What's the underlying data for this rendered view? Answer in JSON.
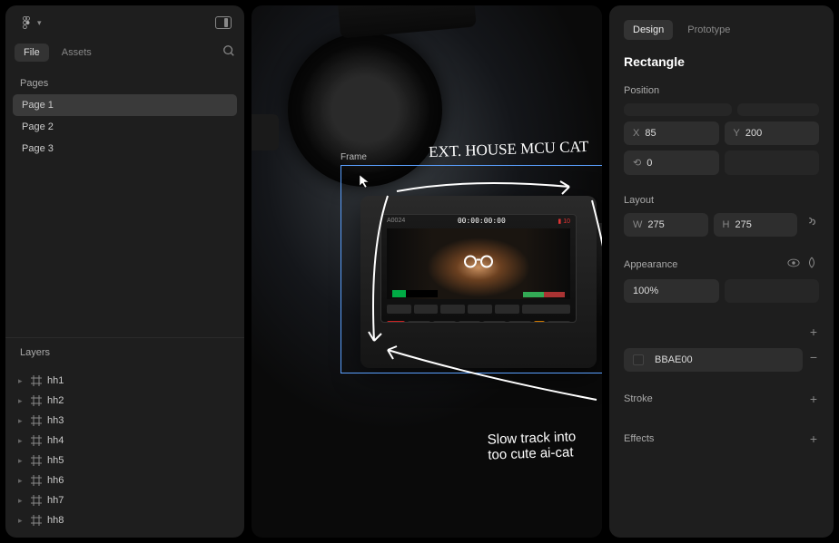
{
  "leftTabs": {
    "file": "File",
    "assets": "Assets"
  },
  "pagesHeader": "Pages",
  "pages": [
    "Page 1",
    "Page 2",
    "Page 3"
  ],
  "activePage": 0,
  "layersHeader": "Layers",
  "layers": [
    "hh1",
    "hh2",
    "hh3",
    "hh4",
    "hh5",
    "hh6",
    "hh7",
    "hh8"
  ],
  "canvas": {
    "frameLabel": "Frame",
    "annotationTop": "EXT. HOUSE  MCU CAT",
    "annotationBottom1": "Slow track into",
    "annotationBottom2": "too cute ai-cat",
    "timecode": "00:00:00:00"
  },
  "right": {
    "tabDesign": "Design",
    "tabPrototype": "Prototype",
    "title": "Rectangle",
    "positionLabel": "Position",
    "xLabel": "X",
    "xVal": "85",
    "yLabel": "Y",
    "yVal": "200",
    "rotIcon": "⟲",
    "rotVal": "0",
    "layoutLabel": "Layout",
    "wLabel": "W",
    "wVal": "275",
    "hLabel": "H",
    "hVal": "275",
    "appearanceLabel": "Appearance",
    "opacityVal": "100%",
    "fillHex": "BBAE00",
    "strokeLabel": "Stroke",
    "effectsLabel": "Effects"
  }
}
